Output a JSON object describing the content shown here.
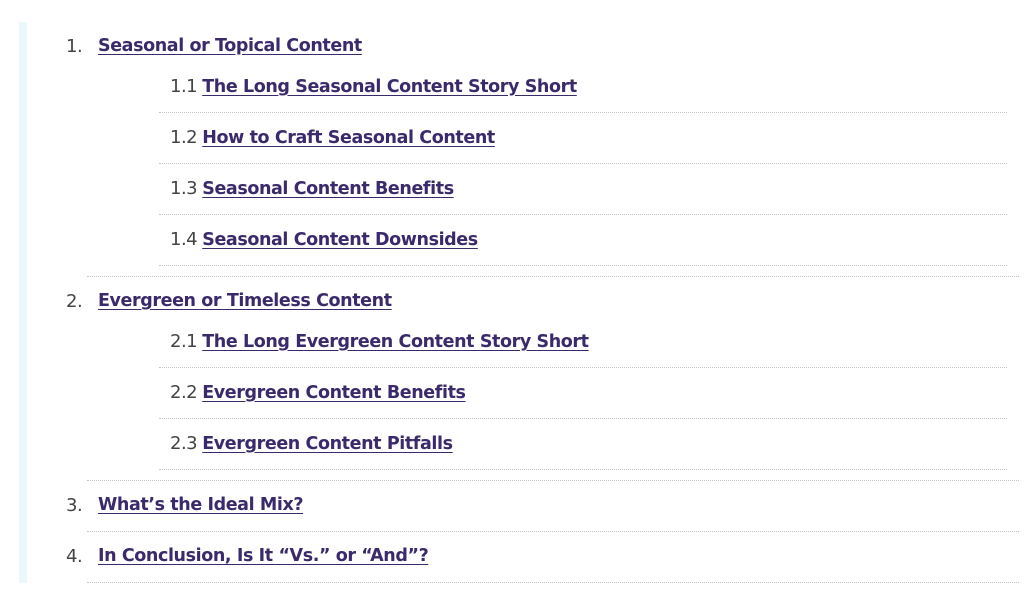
{
  "toc": {
    "items": [
      {
        "number": "1.",
        "label": "Seasonal or Topical Content",
        "children": [
          {
            "number": "1.1",
            "label": "The Long Seasonal Content Story Short"
          },
          {
            "number": "1.2",
            "label": "How to Craft Seasonal Content"
          },
          {
            "number": "1.3",
            "label": "Seasonal Content Benefits"
          },
          {
            "number": "1.4",
            "label": "Seasonal Content Downsides"
          }
        ]
      },
      {
        "number": "2.",
        "label": "Evergreen or Timeless Content",
        "children": [
          {
            "number": "2.1",
            "label": "The Long Evergreen Content Story Short"
          },
          {
            "number": "2.2",
            "label": "Evergreen Content Benefits"
          },
          {
            "number": "2.3",
            "label": "Evergreen Content Pitfalls"
          }
        ]
      },
      {
        "number": "3.",
        "label": "What’s the Ideal Mix?"
      },
      {
        "number": "4.",
        "label": "In Conclusion, Is It “Vs.” or “And”?"
      }
    ]
  },
  "colors": {
    "link": "#3b2a6b",
    "number": "#444444",
    "accent_bar": "#eaf7fd",
    "rule": "#c4c4c4"
  }
}
